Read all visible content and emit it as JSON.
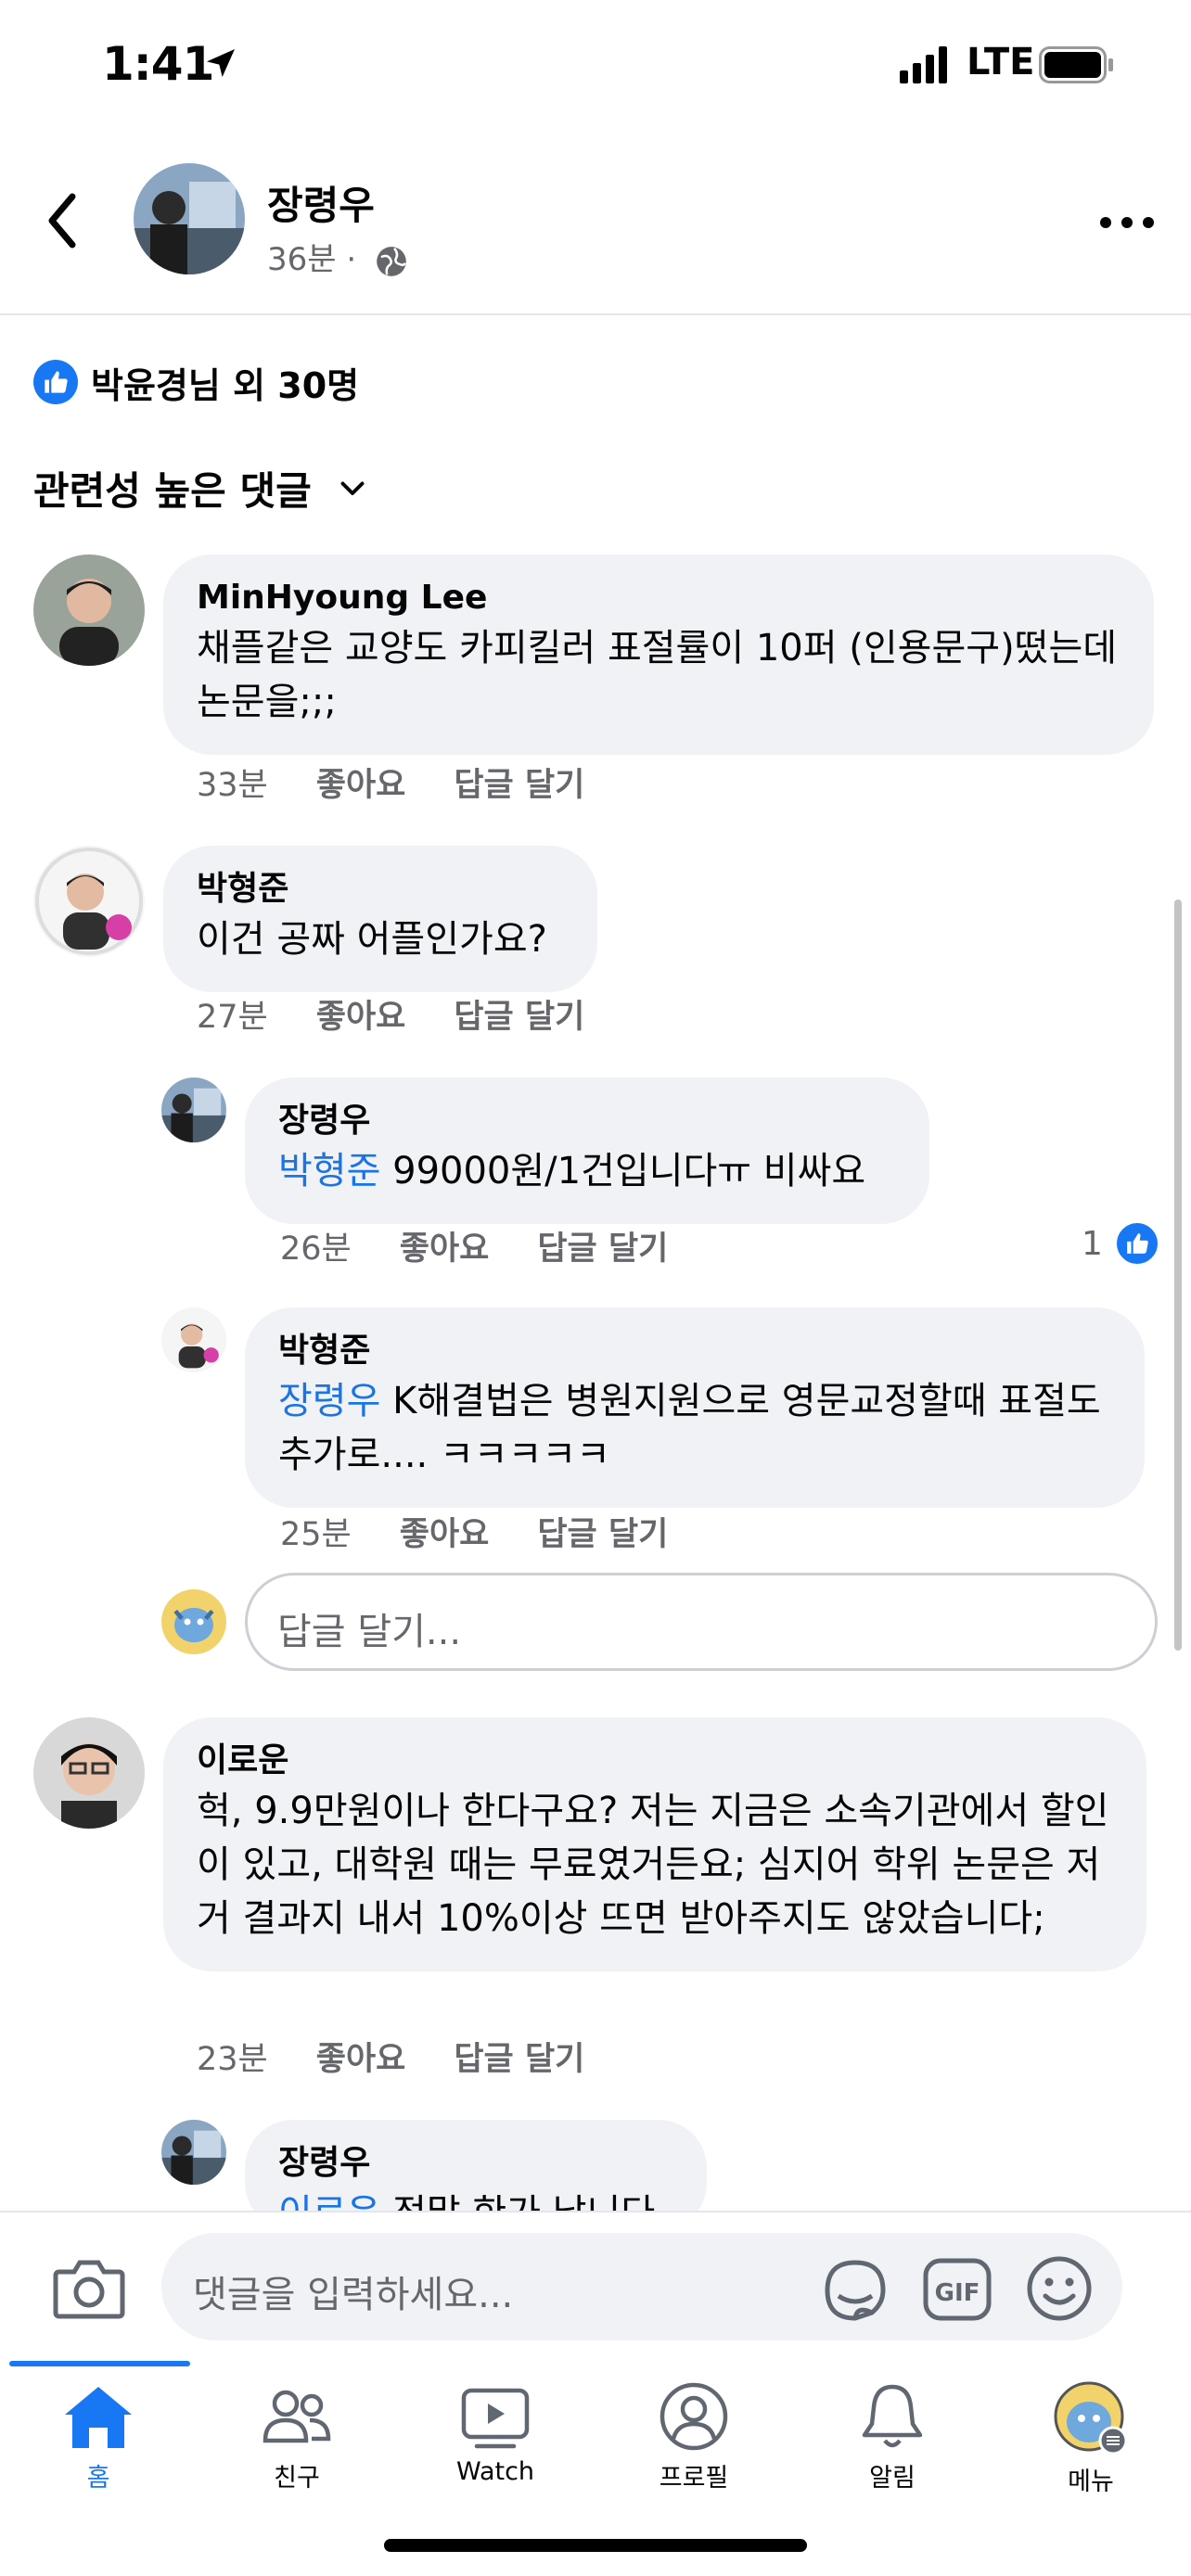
{
  "status_bar": {
    "time": "1:41",
    "network": "LTE"
  },
  "post_header": {
    "author": "장령우",
    "time": "36분",
    "separator": "·"
  },
  "reactions": {
    "summary": "박윤경님 외 30명"
  },
  "sort": {
    "label": "관련성 높은 댓글"
  },
  "comments": [
    {
      "name": "MinHyoung Lee",
      "text": "채플같은 교양도 카피킬러 표절률이 10퍼 (인용문구)떴는데 논문을;;;",
      "time": "33분",
      "like": "좋아요",
      "reply": "답글 달기"
    },
    {
      "name": "박형준",
      "text": "이건 공짜 어플인가요?",
      "time": "27분",
      "like": "좋아요",
      "reply": "답글 달기"
    },
    {
      "name": "장령우",
      "mention": "박형준",
      "text": " 99000원/1건입니다ㅠ 비싸요",
      "time": "26분",
      "like": "좋아요",
      "reply": "답글 달기",
      "like_count": "1"
    },
    {
      "name": "박형준",
      "mention": "장령우",
      "text": " K해결법은 병원지원으로 영문교정할때 표절도 추가로.... ㅋㅋㅋㅋㅋ",
      "time": "25분",
      "like": "좋아요",
      "reply": "답글 달기"
    },
    {
      "name": "이로운",
      "text": "헉, 9.9만원이나 한다구요? 저는 지금은 소속기관에서 할인이 있고, 대학원 때는 무료였거든요; 심지어 학위 논문은 저거 결과지 내서 10%이상 뜨면 받아주지도 않았습니다;",
      "time": "23분",
      "like": "좋아요",
      "reply": "답글 달기"
    },
    {
      "name": "장령우",
      "mention": "이로운",
      "text": " 정말 한가 납니다"
    }
  ],
  "reply_box": {
    "placeholder": "답글 달기..."
  },
  "composer": {
    "placeholder": "댓글을 입력하세요..."
  },
  "nav": [
    {
      "label": "홈",
      "icon": "home-icon",
      "active": true
    },
    {
      "label": "친구",
      "icon": "friends-icon"
    },
    {
      "label": "Watch",
      "icon": "watch-icon"
    },
    {
      "label": "프로필",
      "icon": "profile-icon"
    },
    {
      "label": "알림",
      "icon": "bell-icon"
    },
    {
      "label": "메뉴",
      "icon": "menu-avatar-icon"
    }
  ],
  "colors": {
    "accent": "#1877f2",
    "mention": "#1b74e4",
    "bubble": "#f0f2f5",
    "muted": "#65676b"
  }
}
